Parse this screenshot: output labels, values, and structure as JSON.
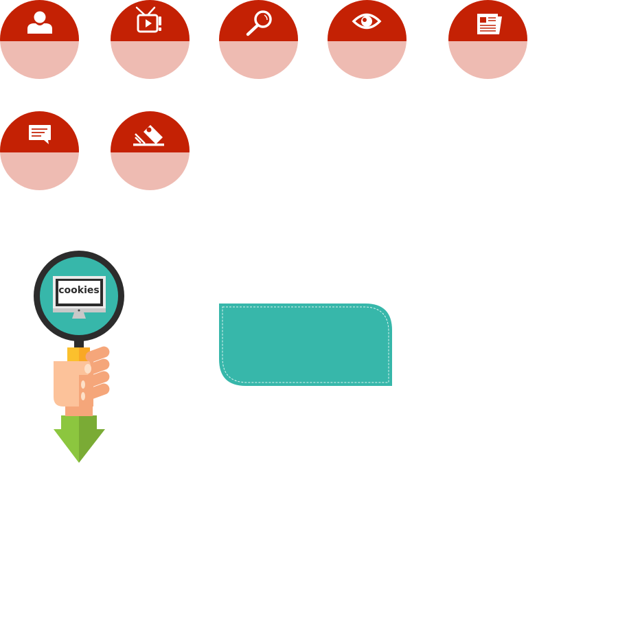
{
  "icons": [
    {
      "name": "user-icon",
      "color": "#c42104"
    },
    {
      "name": "tv-icon",
      "color": "#c42104"
    },
    {
      "name": "search-icon",
      "color": "#c42104"
    },
    {
      "name": "eye-icon",
      "color": "#c42104"
    },
    {
      "name": "newspaper-icon",
      "color": "#c42104"
    },
    {
      "name": "chat-icon",
      "color": "#c42104"
    },
    {
      "name": "ticket-icon",
      "color": "#c42104"
    }
  ],
  "illustration": {
    "screen_text": "cookies",
    "lens_color": "#37b7aa",
    "arrow_color": "#8cc63f"
  },
  "panel": {
    "color": "#37b7aa"
  }
}
